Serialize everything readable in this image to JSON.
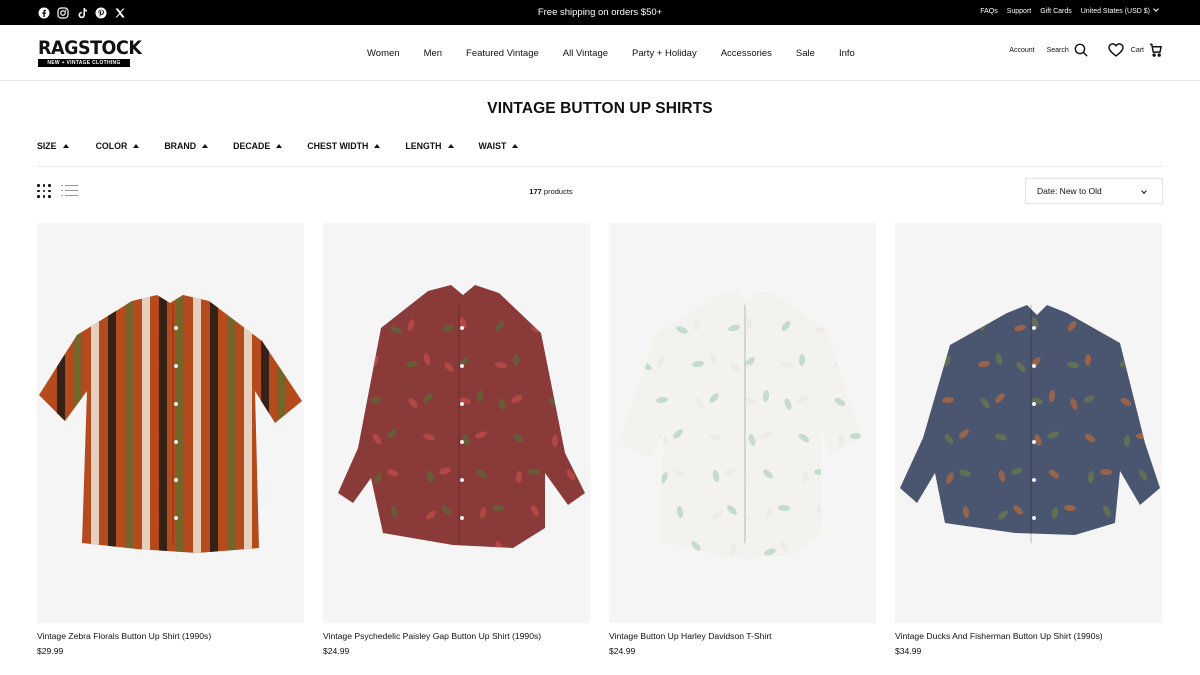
{
  "announcement": {
    "text": "Free shipping on orders $50+"
  },
  "social_icons": [
    "facebook-icon",
    "instagram-icon",
    "tiktok-icon",
    "pinterest-icon",
    "x-icon"
  ],
  "top_links": [
    "FAQs",
    "Support",
    "Gift Cards"
  ],
  "currency": "United States (USD $)",
  "logo": {
    "main": "RAGSTOCK",
    "sub": "NEW + VINTAGE CLOTHING"
  },
  "nav": [
    "Women",
    "Men",
    "Featured Vintage",
    "All Vintage",
    "Party + Holiday",
    "Accessories",
    "Sale",
    "Info"
  ],
  "header_right": {
    "account": "Account",
    "search": "Search",
    "cart": "Cart"
  },
  "page_title": "VINTAGE BUTTON UP SHIRTS",
  "filters": [
    "SIZE",
    "COLOR",
    "BRAND",
    "DECADE",
    "CHEST WIDTH",
    "LENGTH",
    "WAIST"
  ],
  "product_count": {
    "number": "177",
    "label": "products"
  },
  "sort": {
    "selected": "Date: New to Old"
  },
  "products": [
    {
      "name": "Vintage Zebra Florals Button Up Shirt (1990s)",
      "price": "$29.99",
      "colors": {
        "base": "#b54a1c",
        "accent": "#1f1a14",
        "secondary": "#6b6a2a"
      }
    },
    {
      "name": "Vintage Psychedelic Paisley Gap Button Up Shirt (1990s)",
      "price": "$24.99",
      "colors": {
        "base": "#8b3a3a",
        "accent": "#5a6b35",
        "secondary": "#c24f48"
      }
    },
    {
      "name": "Vintage Button Up Harley Davidson T-Shirt",
      "price": "$24.99",
      "colors": {
        "base": "#f4f2ee",
        "accent": "#2e9a6a",
        "secondary": "#dcd9d2"
      }
    },
    {
      "name": "Vintage Ducks And Fisherman Button Up Shirt (1990s)",
      "price": "$34.99",
      "colors": {
        "base": "#4a5670",
        "accent": "#b86a3a",
        "secondary": "#6a7a4a"
      }
    }
  ]
}
